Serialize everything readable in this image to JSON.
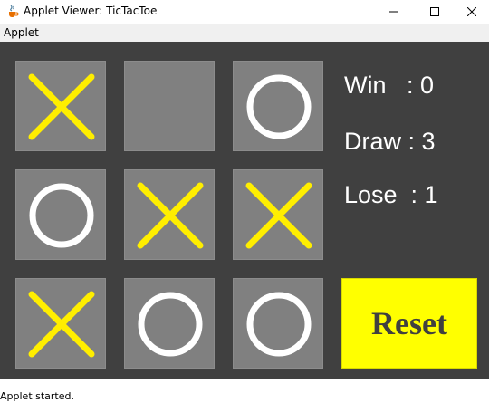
{
  "window": {
    "title": "Applet Viewer: TicTacToe",
    "app_icon": "java-cup-icon",
    "controls": [
      "minimize-icon",
      "maximize-icon",
      "close-icon"
    ]
  },
  "menu": {
    "items": [
      "Applet"
    ]
  },
  "board": {
    "cells": [
      [
        "X",
        "",
        "O"
      ],
      [
        "O",
        "X",
        "X"
      ],
      [
        "X",
        "O",
        "O"
      ]
    ],
    "cell_color": "#808080",
    "x_color": "#ffee00",
    "o_color": "#ffffff",
    "background": "#404040"
  },
  "score": {
    "win_label": "Win   : 0",
    "draw_label": "Draw : 3",
    "lose_label": "Lose  : 1",
    "win": 0,
    "draw": 3,
    "lose": 1
  },
  "reset": {
    "label": "Reset",
    "color": "#ffff00"
  },
  "status": {
    "text": "Applet started."
  }
}
